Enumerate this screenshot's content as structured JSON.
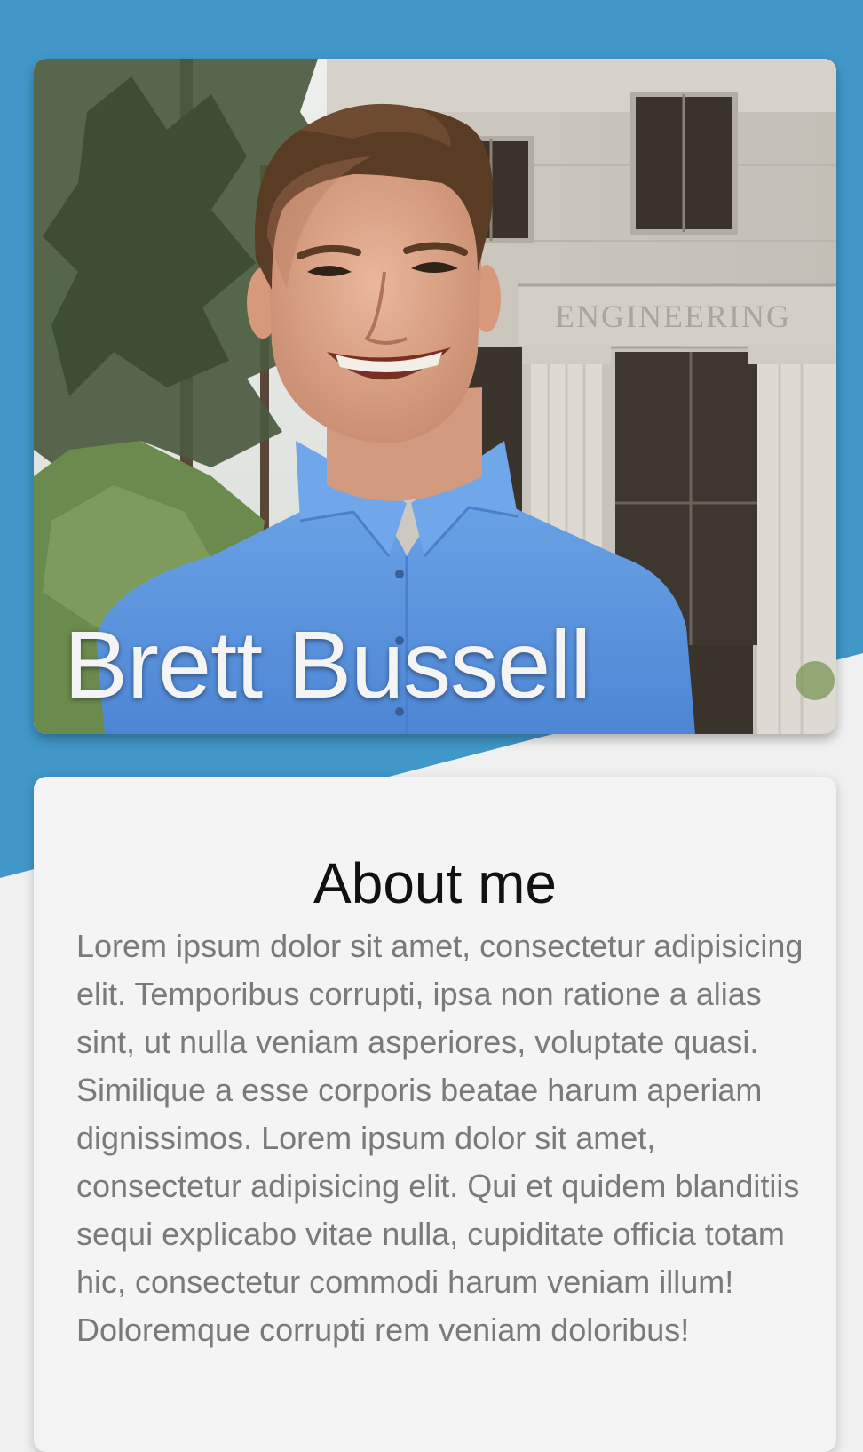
{
  "profile": {
    "name": "Brett Bussell",
    "building_sign": "ENGINEERING"
  },
  "about": {
    "title": "About me",
    "body": "Lorem ipsum dolor sit amet, consectetur adipisicing elit. Temporibus corrupti, ipsa non ratione a alias sint, ut nulla veniam asperiores, voluptate quasi. Similique a esse corporis beatae harum aperiam dignissimos. Lorem ipsum dolor sit amet, consectetur adipisicing elit. Qui et quidem blanditiis sequi explicabo vitae nulla, cupiditate officia totam hic, consectetur commodi harum veniam illum! Doloremque corrupti rem veniam doloribus!"
  },
  "colors": {
    "background_accent": "#4097c8",
    "page_background": "#f0f0f0",
    "card_background": "#f4f4f4",
    "shirt_blue": "#5a92dc",
    "body_text": "#7a7a7a"
  }
}
